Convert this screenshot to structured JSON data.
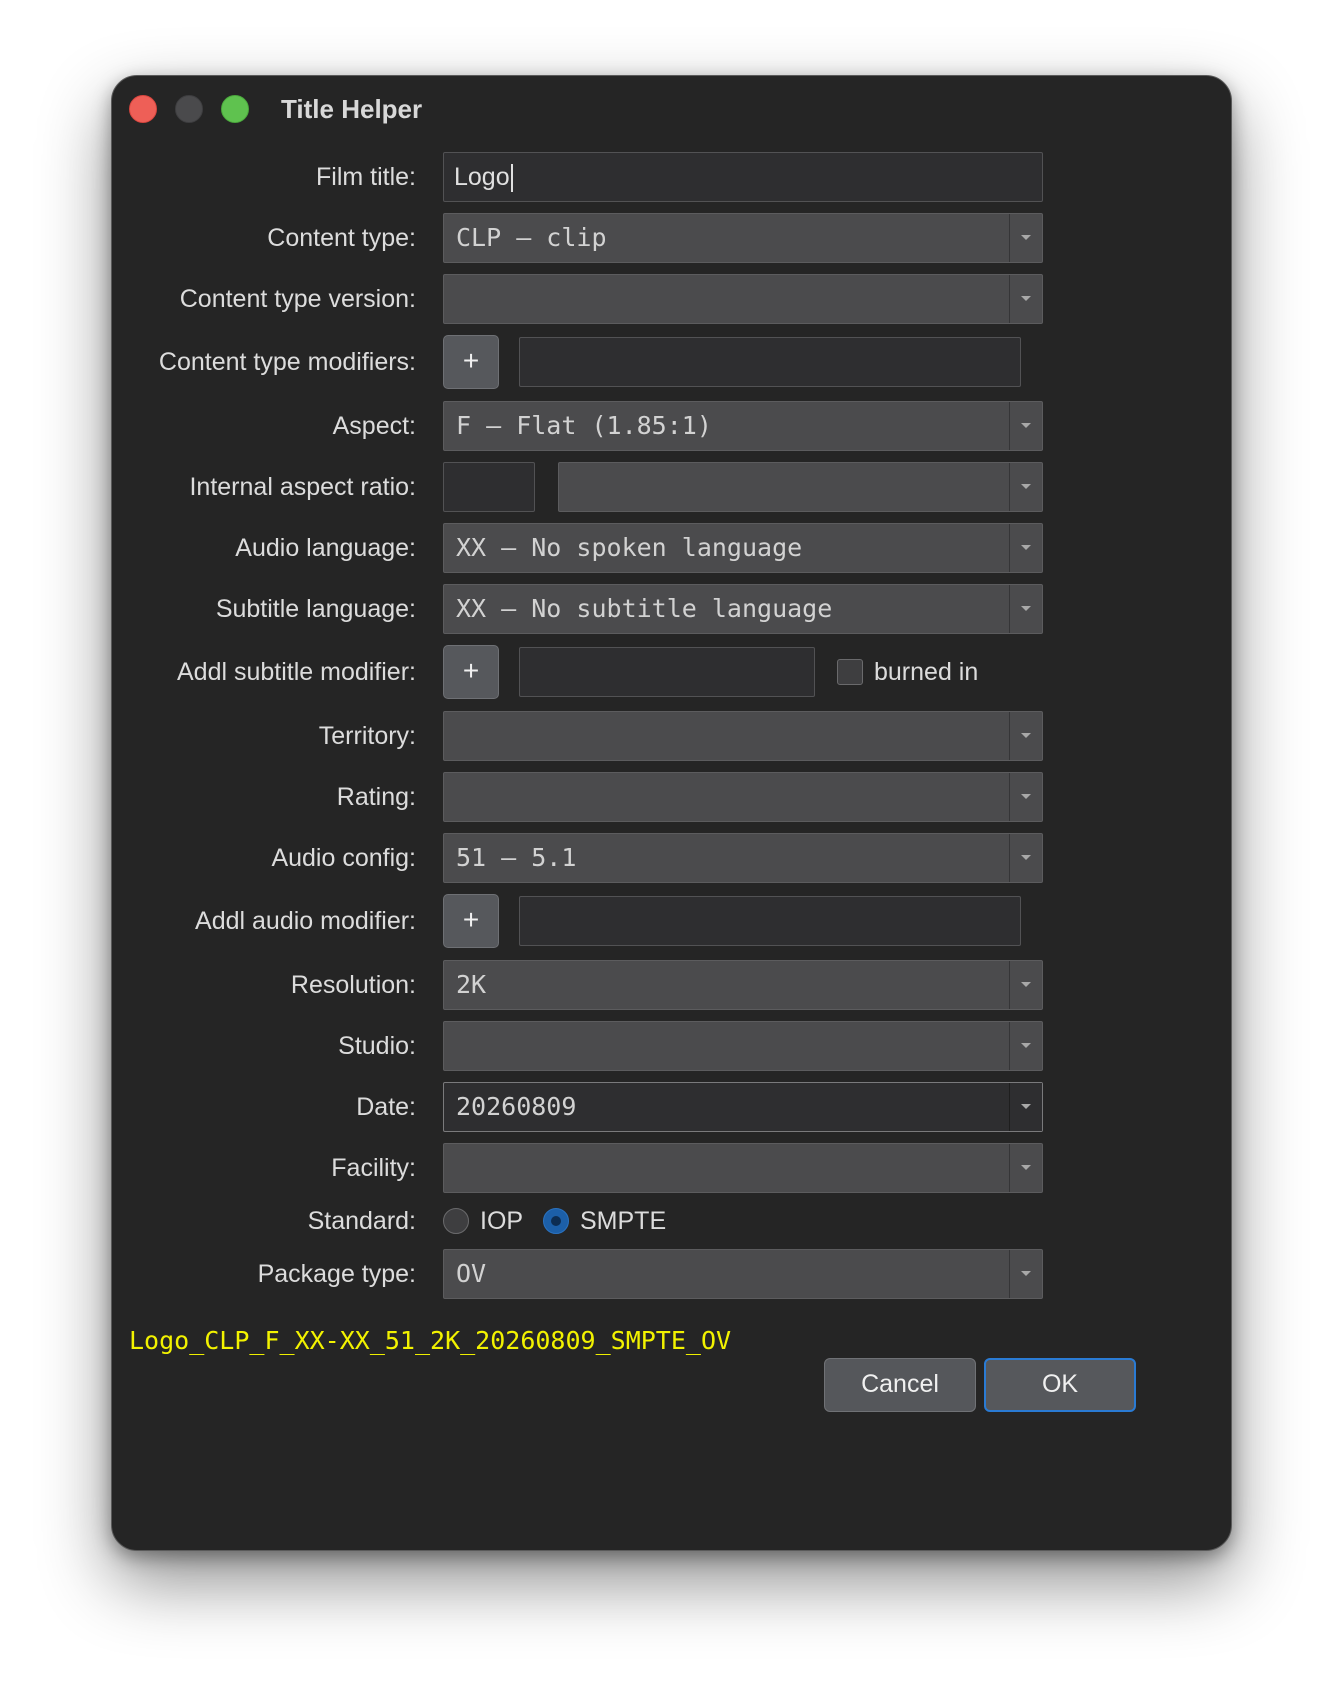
{
  "window": {
    "title": "Title Helper"
  },
  "labels": {
    "film_title": "Film title:",
    "content_type": "Content type:",
    "content_type_version": "Content type version:",
    "content_type_modifiers": "Content type modifiers:",
    "aspect": "Aspect:",
    "internal_aspect_ratio": "Internal aspect ratio:",
    "audio_language": "Audio language:",
    "subtitle_language": "Subtitle language:",
    "addl_subtitle_modifier": "Addl subtitle modifier:",
    "territory": "Territory:",
    "rating": "Rating:",
    "audio_config": "Audio config:",
    "addl_audio_modifier": "Addl audio modifier:",
    "resolution": "Resolution:",
    "studio": "Studio:",
    "date": "Date:",
    "facility": "Facility:",
    "standard": "Standard:",
    "package_type": "Package type:"
  },
  "values": {
    "film_title": "Logo",
    "content_type": "CLP – clip",
    "content_type_version": "",
    "content_type_modifiers": "",
    "aspect": "F – Flat (1.85:1)",
    "internal_aspect_ratio_text": "",
    "internal_aspect_ratio_select": "",
    "audio_language": "XX – No spoken language",
    "subtitle_language": "XX – No subtitle language",
    "addl_subtitle_modifier": "",
    "burned_in_label": "burned in",
    "burned_in_checked": false,
    "territory": "",
    "rating": "",
    "audio_config": "51 – 5.1",
    "addl_audio_modifier": "",
    "resolution": "2K",
    "studio": "",
    "date": "20260809",
    "facility": "",
    "standard_options": [
      "IOP",
      "SMPTE"
    ],
    "standard_selected": "SMPTE",
    "package_type": "OV"
  },
  "plus_label": "+",
  "result_name": "Logo_CLP_F_XX-XX_51_2K_20260809_SMPTE_OV",
  "buttons": {
    "cancel": "Cancel",
    "ok": "OK"
  },
  "colors": {
    "window_bg": "#252525",
    "result_text": "#f2f200",
    "close": "#ee5f57",
    "maximize": "#5fc24f",
    "accent": "#2a7bd4"
  }
}
